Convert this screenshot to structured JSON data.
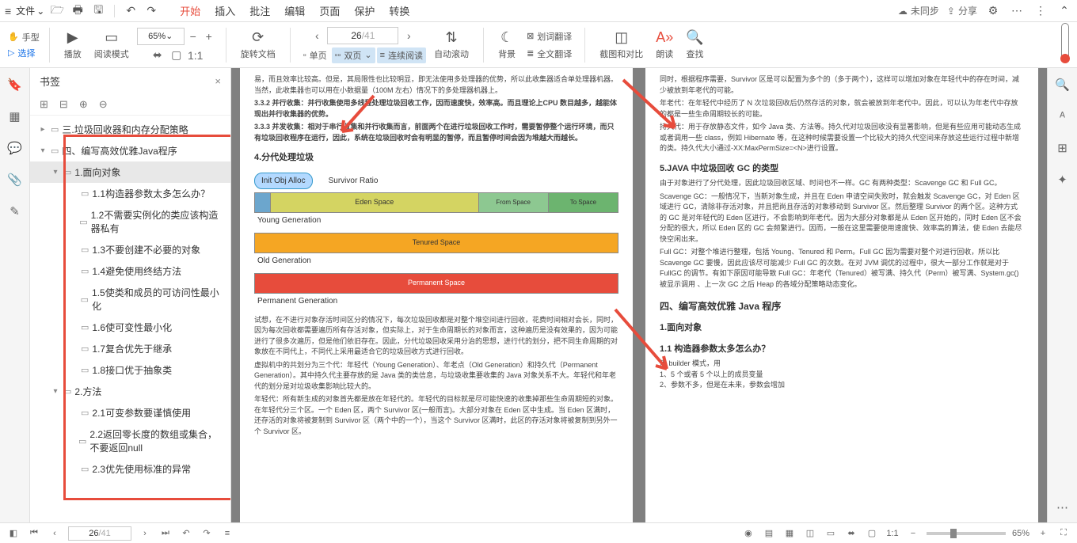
{
  "menubar": {
    "file": "文件",
    "tabs": [
      "开始",
      "插入",
      "批注",
      "编辑",
      "页面",
      "保护",
      "转换"
    ],
    "active_tab": 0,
    "sync": "未同步",
    "share": "分享"
  },
  "toolbar": {
    "hand": "手型",
    "select": "选择",
    "play": "播放",
    "read_mode": "阅读模式",
    "zoom": "65%",
    "rotate": "旋转文档",
    "page_current": "26",
    "page_total": "/41",
    "single_page": "单页",
    "double_page": "双页",
    "continuous": "连续阅读",
    "auto_scroll": "自动滚动",
    "background": "背景",
    "word_translate": "划词翻译",
    "full_translate": "全文翻译",
    "screenshot": "截图和对比",
    "read_aloud": "朗读",
    "find": "查找"
  },
  "bookmark": {
    "title": "书签",
    "items": [
      {
        "level": 1,
        "text": "三.垃圾回收器和内存分配策略",
        "arrow": "▸"
      },
      {
        "level": 1,
        "text": "四、编写高效优雅Java程序",
        "arrow": "▾"
      },
      {
        "level": 2,
        "text": "1.面向对象",
        "arrow": "▾",
        "active": true
      },
      {
        "level": 3,
        "text": "1.1构造器参数太多怎么办？"
      },
      {
        "level": 3,
        "text": "1.2不需要实例化的类应该构造器私有"
      },
      {
        "level": 3,
        "text": "1.3不要创建不必要的对象"
      },
      {
        "level": 3,
        "text": "1.4避免使用终结方法"
      },
      {
        "level": 3,
        "text": "1.5使类和成员的可访问性最小化"
      },
      {
        "level": 3,
        "text": "1.6使可变性最小化"
      },
      {
        "level": 3,
        "text": "1.7复合优先于继承"
      },
      {
        "level": 3,
        "text": "1.8接口优于抽象类"
      },
      {
        "level": 2,
        "text": "2.方法",
        "arrow": "▾"
      },
      {
        "level": 3,
        "text": "2.1可变参数要谨慎使用"
      },
      {
        "level": 3,
        "text": "2.2返回零长度的数组或集合，不要返回null"
      },
      {
        "level": 3,
        "text": "2.3优先使用标准的异常"
      }
    ]
  },
  "doc": {
    "left": {
      "intro": "易，而且效率比较高。但是，其局限性也比较明显，即无法使用多处理器的优势，所以此收集器适合单处理器机器。当然，此收集器也可以用在小数据量（100M 左右）情况下的多处理器机器上。",
      "l1": "3.3.2 并行收集：并行收集使用多线程处理垃圾回收工作，因而速度快，效率高。而且理论上CPU 数目越多，越能体现出并行收集器的优势。",
      "l2": "3.3.3 并发收集：相对于串行收集和并行收集而言，前面两个在进行垃圾回收工作时，需要暂停整个运行环境，而只有垃圾回收程序在运行，因此，系统在垃圾回收时会有明显的暂停，而且暂停时间会因为堆越大而越长。",
      "h4_1": "4.分代处理垃圾",
      "diagram": {
        "init": "Init Obj Alloc",
        "sratio": "Survivor Ratio",
        "eden": "Eden Space",
        "from": "From Space",
        "to": "To Space",
        "young": "Young Generation",
        "tenured": "Tenured Space",
        "old": "Old Generation",
        "perm": "Permanent Space",
        "permgen": "Permanent Generation"
      },
      "p1": "试想，在不进行对象存活时间区分的情况下，每次垃圾回收都是对整个堆空间进行回收，花费时间相对会长，同时，因为每次回收都需要遍历所有存活对象，但实际上，对于生命周期长的对象而言，这种遍历是没有效果的，因为可能进行了很多次遍历，但是他们依旧存在。因此，分代垃圾回收采用分治的思想，进行代的划分，把不同生命周期的对象放在不同代上，不同代上采用最适合它的垃圾回收方式进行回收。",
      "p2": "虚拟机中的共划分为三个代：年轻代（Young Generation）、年老点（Old Generation）和持久代（Permanent Generation）。其中持久代主要存放的是 Java 类的类信息，与垃圾收集要收集的 Java 对象关系不大。年轻代和年老代的划分是对垃圾收集影响比较大的。",
      "p3": "年轻代：所有新生成的对象首先都是放在年轻代的。年轻代的目标就是尽可能快速的收集掉那些生命周期短的对象。在年轻代分三个区。一个 Eden 区，两个 Survivor 区(一般而言)。大部分对象在 Eden 区中生成。当 Eden 区满时，还存活的对象将被复制到 Survivor 区（两个中的一个），当这个 Survivor 区满时，此区的存活对象将被复制到另外一个 Survivor 区。"
    },
    "right": {
      "r0": "同时，根据程序需要，Survivor 区是可以配置为多个的（多于两个），这样可以增加对象在年轻代中的存在时间，减少被放到年老代的可能。",
      "r1": "年老代：在年轻代中经历了 N 次垃圾回收后仍然存活的对象，就会被放到年老代中。因此，可以认为年老代中存放的都是一些生命周期较长的可能。",
      "r2": "持久代：用于存放静态文件，如今 Java 类、方法等。持久代对垃圾回收没有显著影响，但是有些应用可能动态生成或者调用一些 class，例如 Hibernate 等，在这种时候需要设置一个比较大的持久代空间来存放这些运行过程中新增的类。持久代大小通过-XX:MaxPermSize=<N>进行设置。",
      "h5": "5.JAVA 中垃圾回收 GC 的类型",
      "r3": "由于对象进行了分代处理，因此垃圾回收区域、时间也不一样。GC 有两种类型：Scavenge GC 和 Full GC。",
      "r4": "Scavenge GC：一般情况下，当新对象生成，并且在 Eden 申请空间失败时，就会触发 Scavenge GC，对 Eden 区域进行 GC，清除非存活对象，并且把尚且存活的对象移动到 Survivor 区。然后整理 Survivor 的两个区。这种方式的 GC 是对年轻代的 Eden 区进行，不会影响到年老代。因为大部分对象都是从 Eden 区开始的，同时 Eden 区不会分配的很大，所以 Eden 区的 GC 会频繁进行。因而，一般在这里需要使用速度快、效率高的算法，使 Eden 去能尽快空闲出来。",
      "r5": "Full GC：对整个堆进行整理，包括 Young、Tenured 和 Perm。Full GC 因为需要对整个对进行回收，所以比 Scavenge GC 要慢，因此应该尽可能减少 Full GC 的次数。在对 JVM 调优的过程中，很大一部分工作就是对于FullGC 的调节。有如下原因可能导致 Full GC：年老代（Tenured）被写满、持久代（Perm）被写满、System.gc()被显示调用 、上一次 GC 之后 Heap 的各域分配策略动态变化。",
      "h4_2": "四、编写高效优雅 Java 程序",
      "h3_1": "1.面向对象",
      "h_11": "1.1 构造器参数太多怎么办？",
      "r6": "用 builder 模式，用\n1、5 个或者 5 个以上的成员变量\n2、参数不多，但是在未来，参数会增加"
    }
  },
  "statusbar": {
    "page_current": "26",
    "page_total": "/41",
    "zoom": "65%"
  }
}
